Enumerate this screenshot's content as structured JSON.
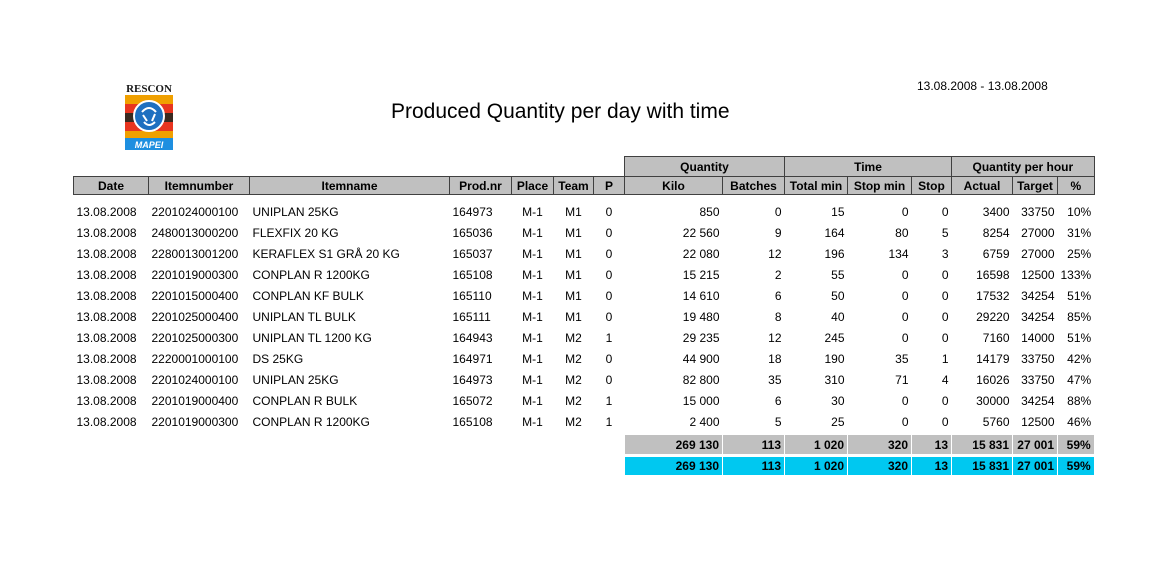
{
  "logo": {
    "top_text": "RESCON",
    "bottom_text": "MAPEI"
  },
  "title": "Produced Quantity per day with time",
  "date_range": "13.08.2008 - 13.08.2008",
  "groups": {
    "quantity": "Quantity",
    "time": "Time",
    "qph": "Quantity per hour"
  },
  "columns": [
    "Date",
    "Itemnumber",
    "Itemname",
    "Prod.nr",
    "Place",
    "Team",
    "P",
    "Kilo",
    "Batches",
    "Total min",
    "Stop min",
    "Stop",
    "Actual",
    "Target",
    "%"
  ],
  "rows": [
    [
      "13.08.2008",
      "2201024000100",
      "UNIPLAN 25KG",
      "164973",
      "M-1",
      "M1",
      "0",
      "850",
      "0",
      "15",
      "0",
      "0",
      "3400",
      "33750",
      "10%"
    ],
    [
      "13.08.2008",
      "2480013000200",
      "FLEXFIX 20 KG",
      "165036",
      "M-1",
      "M1",
      "0",
      "22 560",
      "9",
      "164",
      "80",
      "5",
      "8254",
      "27000",
      "31%"
    ],
    [
      "13.08.2008",
      "2280013001200",
      "KERAFLEX S1 GRÅ 20 KG",
      "165037",
      "M-1",
      "M1",
      "0",
      "22 080",
      "12",
      "196",
      "134",
      "3",
      "6759",
      "27000",
      "25%"
    ],
    [
      "13.08.2008",
      "2201019000300",
      "CONPLAN R 1200KG",
      "165108",
      "M-1",
      "M1",
      "0",
      "15 215",
      "2",
      "55",
      "0",
      "0",
      "16598",
      "12500",
      "133%"
    ],
    [
      "13.08.2008",
      "2201015000400",
      "CONPLAN KF BULK",
      "165110",
      "M-1",
      "M1",
      "0",
      "14 610",
      "6",
      "50",
      "0",
      "0",
      "17532",
      "34254",
      "51%"
    ],
    [
      "13.08.2008",
      "2201025000400",
      "UNIPLAN TL BULK",
      "165111",
      "M-1",
      "M1",
      "0",
      "19 480",
      "8",
      "40",
      "0",
      "0",
      "29220",
      "34254",
      "85%"
    ],
    [
      "13.08.2008",
      "2201025000300",
      "UNIPLAN TL 1200 KG",
      "164943",
      "M-1",
      "M2",
      "1",
      "29 235",
      "12",
      "245",
      "0",
      "0",
      "7160",
      "14000",
      "51%"
    ],
    [
      "13.08.2008",
      "2220001000100",
      "DS 25KG",
      "164971",
      "M-1",
      "M2",
      "0",
      "44 900",
      "18",
      "190",
      "35",
      "1",
      "14179",
      "33750",
      "42%"
    ],
    [
      "13.08.2008",
      "2201024000100",
      "UNIPLAN 25KG",
      "164973",
      "M-1",
      "M2",
      "0",
      "82 800",
      "35",
      "310",
      "71",
      "4",
      "16026",
      "33750",
      "47%"
    ],
    [
      "13.08.2008",
      "2201019000400",
      "CONPLAN R BULK",
      "165072",
      "M-1",
      "M2",
      "1",
      "15 000",
      "6",
      "30",
      "0",
      "0",
      "30000",
      "34254",
      "88%"
    ],
    [
      "13.08.2008",
      "2201019000300",
      "CONPLAN R 1200KG",
      "165108",
      "M-1",
      "M2",
      "1",
      "2 400",
      "5",
      "25",
      "0",
      "0",
      "5760",
      "12500",
      "46%"
    ]
  ],
  "totals": [
    "269 130",
    "113",
    "1 020",
    "320",
    "13",
    "15 831",
    "27 001",
    "59%"
  ],
  "grand_totals": [
    "269 130",
    "113",
    "1 020",
    "320",
    "13",
    "15 831",
    "27 001",
    "59%"
  ],
  "colors": {
    "header_gray": "#c0c0c0",
    "total_cyan": "#00c8f0"
  }
}
